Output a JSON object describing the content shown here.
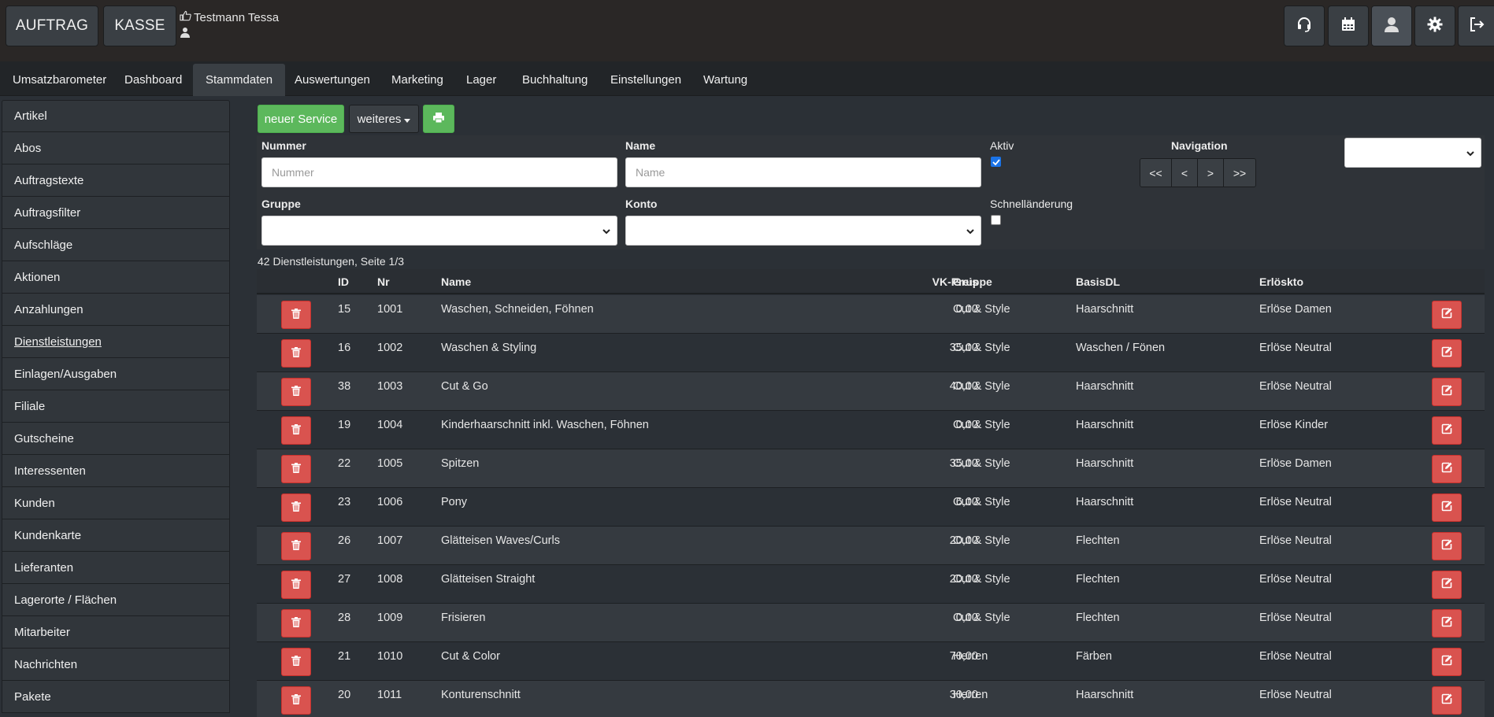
{
  "header": {
    "auftrag_label": "AUFTRAG",
    "kasse_label": "KASSE",
    "user_name": "Testmann Tessa",
    "icons": [
      "headset-icon",
      "calendar-icon",
      "user-icon",
      "gear-icon",
      "logout-icon"
    ]
  },
  "nav": {
    "tabs": [
      "Umsatzbarometer",
      "Dashboard",
      "Stammdaten",
      "Auswertungen",
      "Marketing",
      "Lager",
      "Buchhaltung",
      "Einstellungen",
      "Wartung"
    ],
    "active": "Stammdaten"
  },
  "sidebar": {
    "items": [
      "Artikel",
      "Abos",
      "Auftragstexte",
      "Auftragsfilter",
      "Aufschläge",
      "Aktionen",
      "Anzahlungen",
      "Dienstleistungen",
      "Einlagen/Ausgaben",
      "Filiale",
      "Gutscheine",
      "Interessenten",
      "Kunden",
      "Kundenkarte",
      "Lieferanten",
      "Lagerorte / Flächen",
      "Mitarbeiter",
      "Nachrichten",
      "Pakete"
    ],
    "active": "Dienstleistungen"
  },
  "toolbar": {
    "new_label": "neuer Service",
    "more_label": "weiteres",
    "print_icon": "print-icon"
  },
  "filter": {
    "nummer_label": "Nummer",
    "nummer_placeholder": "Nummer",
    "name_label": "Name",
    "name_placeholder": "Name",
    "aktiv_label": "Aktiv",
    "aktiv_checked": true,
    "navigation_label": "Navigation",
    "nav_buttons": [
      "<<",
      "<",
      ">",
      ">>"
    ],
    "gruppe_label": "Gruppe",
    "konto_label": "Konto",
    "schnell_label": "Schnelländerung",
    "schnell_checked": false
  },
  "table": {
    "count_text": "42 Dienstleistungen, Seite 1/3",
    "headers": {
      "id": "ID",
      "nr": "Nr",
      "name": "Name",
      "vk": "VK-Preis",
      "gruppe": "Gruppe",
      "basis": "BasisDL",
      "erloes": "Erlöskto"
    },
    "rows": [
      {
        "id": "15",
        "nr": "1001",
        "name": "Waschen, Schneiden, Föhnen",
        "vk": "0,00",
        "gruppe": "Cut & Style",
        "basis": "Haarschnitt",
        "erloes": "Erlöse Damen"
      },
      {
        "id": "16",
        "nr": "1002",
        "name": "Waschen & Styling",
        "vk": "35,00",
        "gruppe": "Cut & Style",
        "basis": "Waschen / Fönen",
        "erloes": "Erlöse Neutral"
      },
      {
        "id": "38",
        "nr": "1003",
        "name": "Cut & Go",
        "vk": "40,00",
        "gruppe": "Cut & Style",
        "basis": "Haarschnitt",
        "erloes": "Erlöse Neutral"
      },
      {
        "id": "19",
        "nr": "1004",
        "name": "Kinderhaarschnitt inkl. Waschen, Föhnen",
        "vk": "0,00",
        "gruppe": "Cut & Style",
        "basis": "Haarschnitt",
        "erloes": "Erlöse Kinder"
      },
      {
        "id": "22",
        "nr": "1005",
        "name": "Spitzen",
        "vk": "35,00",
        "gruppe": "Cut & Style",
        "basis": "Haarschnitt",
        "erloes": "Erlöse Damen"
      },
      {
        "id": "23",
        "nr": "1006",
        "name": "Pony",
        "vk": "6,00",
        "gruppe": "Cut & Style",
        "basis": "Haarschnitt",
        "erloes": "Erlöse Neutral"
      },
      {
        "id": "26",
        "nr": "1007",
        "name": "Glätteisen Waves/Curls",
        "vk": "20,00",
        "gruppe": "Cut & Style",
        "basis": "Flechten",
        "erloes": "Erlöse Neutral"
      },
      {
        "id": "27",
        "nr": "1008",
        "name": "Glätteisen Straight",
        "vk": "20,00",
        "gruppe": "Cut & Style",
        "basis": "Flechten",
        "erloes": "Erlöse Neutral"
      },
      {
        "id": "28",
        "nr": "1009",
        "name": "Frisieren",
        "vk": "0,00",
        "gruppe": "Cut & Style",
        "basis": "Flechten",
        "erloes": "Erlöse Neutral"
      },
      {
        "id": "21",
        "nr": "1010",
        "name": "Cut & Color",
        "vk": "70,00",
        "gruppe": "Herren",
        "basis": "Färben",
        "erloes": "Erlöse Neutral"
      },
      {
        "id": "20",
        "nr": "1011",
        "name": "Konturenschnitt",
        "vk": "30,00",
        "gruppe": "Herren",
        "basis": "Haarschnitt",
        "erloes": "Erlöse Neutral"
      }
    ]
  },
  "colors": {
    "background": "#2b3036",
    "green": "#5cb85c",
    "red": "#d9534f"
  }
}
